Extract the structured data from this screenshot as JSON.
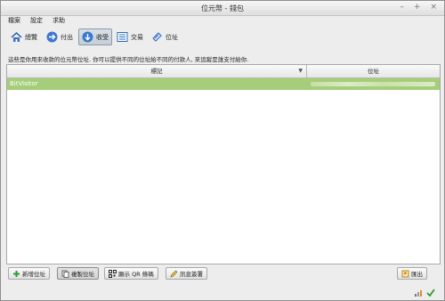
{
  "window": {
    "title": "位元幣 - 錢包"
  },
  "menu": [
    "檔案",
    "設定",
    "求助"
  ],
  "toolbar": {
    "overview": "總覽",
    "send": "付出",
    "receive": "收受",
    "transactions": "交易",
    "address_book": "位址"
  },
  "description": "這些是你用來收款的位元幣位址. 你可以提供不同的位址給不同的付款人, 來追蹤是誰支付給你.",
  "table": {
    "columns": [
      "標記",
      "位址"
    ],
    "rows": [
      {
        "label": "BitVisitor"
      }
    ]
  },
  "buttons": {
    "new_address": "新增位址",
    "copy_address": "複製位址",
    "show_qr": "顯示 QR 條碼",
    "sign_message": "訊息簽署",
    "export": "匯出"
  },
  "colors": {
    "selection": "#a6cd7a",
    "accent": "#2a6bb8"
  }
}
